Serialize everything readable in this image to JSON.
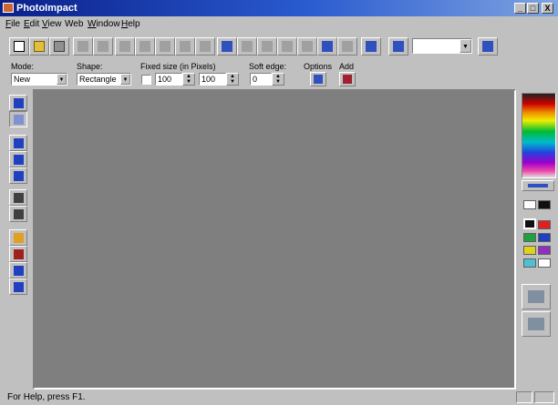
{
  "window": {
    "title": "PhotoImpact",
    "minimize": "_",
    "maximize": "□",
    "close": "X"
  },
  "menu": [
    {
      "label": "File",
      "u": "F",
      "rest": "ile"
    },
    {
      "label": "Edit",
      "u": "E",
      "rest": "dit"
    },
    {
      "label": "View",
      "u": "V",
      "rest": "iew"
    },
    {
      "label": "Web",
      "u": "",
      "rest": "Web"
    },
    {
      "label": "Window",
      "u": "W",
      "rest": "indow"
    },
    {
      "label": "Help",
      "u": "H",
      "rest": "elp"
    }
  ],
  "toolbar": {
    "buttons": [
      "new-icon",
      "open-icon",
      "save-icon",
      "print-icon",
      "print-preview-icon",
      "cut-icon",
      "copy-icon",
      "paste-icon",
      "undo-icon",
      "redo-icon",
      "rotate-icon",
      "flip-icon",
      "resize-icon",
      "crop-icon",
      "mask-icon",
      "effects-icon",
      "photo-icon",
      "camera-icon",
      "gallery-icon"
    ],
    "combo_value": "",
    "help_icon": "context-help-icon"
  },
  "attributes": {
    "mode_label": "Mode:",
    "mode_value": "New",
    "shape_label": "Shape:",
    "shape_value": "Rectangle",
    "fixed_label": "Fixed size (in Pixels)",
    "width_value": "100",
    "height_value": "100",
    "soft_label": "Soft edge:",
    "soft_value": "0",
    "options_label": "Options",
    "add_label": "Add"
  },
  "tools": [
    "pick-tool-icon",
    "selection-tool-icon",
    "text-tool-icon",
    "transform-tool-icon",
    "crop-tool-icon",
    "line-tool-icon",
    "zoom-tool-icon",
    "fill-tool-icon",
    "paint-tool-icon",
    "retouch-tool-icon",
    "stamp-tool-icon"
  ],
  "palette": {
    "colors": [
      "#ffffff",
      "#101010",
      "#101010",
      "#e02020",
      "#20a040",
      "#2040c0",
      "#e0d020",
      "#9030c0",
      "#50c0d0",
      "#ffffff"
    ]
  },
  "status": {
    "text": "For Help, press F1."
  }
}
